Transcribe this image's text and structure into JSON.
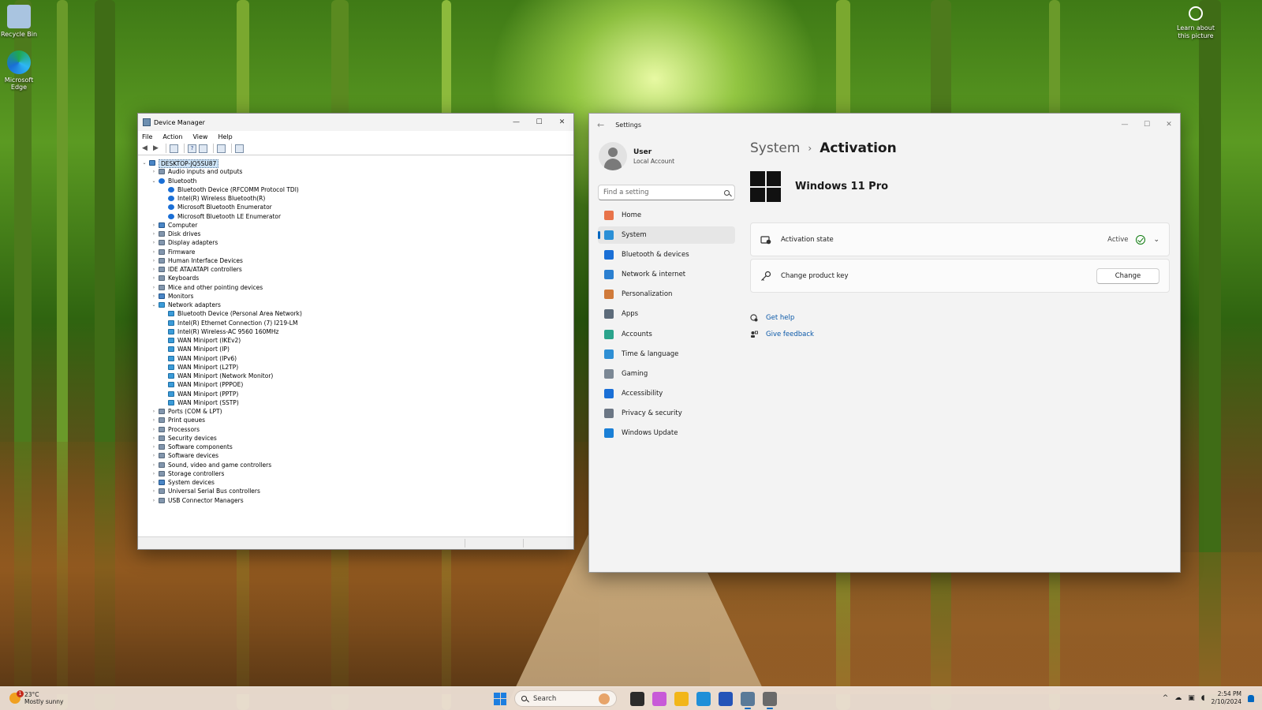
{
  "desktop": {
    "icons": [
      {
        "label": "Recycle Bin"
      },
      {
        "label": "Microsoft Edge"
      }
    ],
    "learn_picture": "Learn about this picture"
  },
  "device_manager": {
    "title": "Device Manager",
    "menu": [
      "File",
      "Action",
      "View",
      "Help"
    ],
    "toolbar_icons": [
      "back-arrow-icon",
      "forward-arrow-icon",
      "properties-icon",
      "help-icon",
      "view-icon",
      "scan-hardware-icon",
      "monitor-icon"
    ],
    "tree": [
      {
        "label": "DESKTOP-JQ5SU87",
        "level": 0,
        "expander": "expanded",
        "icon": "pc",
        "root": true
      },
      {
        "label": "Audio inputs and outputs",
        "level": 1,
        "expander": "collapsed",
        "icon": "cat"
      },
      {
        "label": "Bluetooth",
        "level": 1,
        "expander": "expanded",
        "icon": "bt"
      },
      {
        "label": "Bluetooth Device (RFCOMM Protocol TDI)",
        "level": 2,
        "expander": "none",
        "icon": "bt"
      },
      {
        "label": "Intel(R) Wireless Bluetooth(R)",
        "level": 2,
        "expander": "none",
        "icon": "bt"
      },
      {
        "label": "Microsoft Bluetooth Enumerator",
        "level": 2,
        "expander": "none",
        "icon": "bt"
      },
      {
        "label": "Microsoft Bluetooth LE Enumerator",
        "level": 2,
        "expander": "none",
        "icon": "bt"
      },
      {
        "label": "Computer",
        "level": 1,
        "expander": "collapsed",
        "icon": "pc"
      },
      {
        "label": "Disk drives",
        "level": 1,
        "expander": "collapsed",
        "icon": "cat"
      },
      {
        "label": "Display adapters",
        "level": 1,
        "expander": "collapsed",
        "icon": "cat"
      },
      {
        "label": "Firmware",
        "level": 1,
        "expander": "collapsed",
        "icon": "cat"
      },
      {
        "label": "Human Interface Devices",
        "level": 1,
        "expander": "collapsed",
        "icon": "cat"
      },
      {
        "label": "IDE ATA/ATAPI controllers",
        "level": 1,
        "expander": "collapsed",
        "icon": "cat"
      },
      {
        "label": "Keyboards",
        "level": 1,
        "expander": "collapsed",
        "icon": "cat"
      },
      {
        "label": "Mice and other pointing devices",
        "level": 1,
        "expander": "collapsed",
        "icon": "cat"
      },
      {
        "label": "Monitors",
        "level": 1,
        "expander": "collapsed",
        "icon": "pc"
      },
      {
        "label": "Network adapters",
        "level": 1,
        "expander": "expanded",
        "icon": "net"
      },
      {
        "label": "Bluetooth Device (Personal Area Network)",
        "level": 2,
        "expander": "none",
        "icon": "net"
      },
      {
        "label": "Intel(R) Ethernet Connection (7) I219-LM",
        "level": 2,
        "expander": "none",
        "icon": "net"
      },
      {
        "label": "Intel(R) Wireless-AC 9560 160MHz",
        "level": 2,
        "expander": "none",
        "icon": "net"
      },
      {
        "label": "WAN Miniport (IKEv2)",
        "level": 2,
        "expander": "none",
        "icon": "net"
      },
      {
        "label": "WAN Miniport (IP)",
        "level": 2,
        "expander": "none",
        "icon": "net"
      },
      {
        "label": "WAN Miniport (IPv6)",
        "level": 2,
        "expander": "none",
        "icon": "net"
      },
      {
        "label": "WAN Miniport (L2TP)",
        "level": 2,
        "expander": "none",
        "icon": "net"
      },
      {
        "label": "WAN Miniport (Network Monitor)",
        "level": 2,
        "expander": "none",
        "icon": "net"
      },
      {
        "label": "WAN Miniport (PPPOE)",
        "level": 2,
        "expander": "none",
        "icon": "net"
      },
      {
        "label": "WAN Miniport (PPTP)",
        "level": 2,
        "expander": "none",
        "icon": "net"
      },
      {
        "label": "WAN Miniport (SSTP)",
        "level": 2,
        "expander": "none",
        "icon": "net"
      },
      {
        "label": "Ports (COM & LPT)",
        "level": 1,
        "expander": "collapsed",
        "icon": "cat"
      },
      {
        "label": "Print queues",
        "level": 1,
        "expander": "collapsed",
        "icon": "cat"
      },
      {
        "label": "Processors",
        "level": 1,
        "expander": "collapsed",
        "icon": "cat"
      },
      {
        "label": "Security devices",
        "level": 1,
        "expander": "collapsed",
        "icon": "cat"
      },
      {
        "label": "Software components",
        "level": 1,
        "expander": "collapsed",
        "icon": "cat"
      },
      {
        "label": "Software devices",
        "level": 1,
        "expander": "collapsed",
        "icon": "cat"
      },
      {
        "label": "Sound, video and game controllers",
        "level": 1,
        "expander": "collapsed",
        "icon": "cat"
      },
      {
        "label": "Storage controllers",
        "level": 1,
        "expander": "collapsed",
        "icon": "cat"
      },
      {
        "label": "System devices",
        "level": 1,
        "expander": "collapsed",
        "icon": "pc"
      },
      {
        "label": "Universal Serial Bus controllers",
        "level": 1,
        "expander": "collapsed",
        "icon": "cat"
      },
      {
        "label": "USB Connector Managers",
        "level": 1,
        "expander": "collapsed",
        "icon": "cat"
      }
    ]
  },
  "settings": {
    "title": "Settings",
    "user": {
      "name": "User",
      "account": "Local Account"
    },
    "search_placeholder": "Find a setting",
    "nav": [
      {
        "label": "Home",
        "icon": "home-icon",
        "color": "#e8734a",
        "active": false
      },
      {
        "label": "System",
        "icon": "system-icon",
        "color": "#2a8fd6",
        "active": true
      },
      {
        "label": "Bluetooth & devices",
        "icon": "bluetooth-icon",
        "color": "#1a6fd6",
        "active": false
      },
      {
        "label": "Network & internet",
        "icon": "wifi-icon",
        "color": "#2b7fd0",
        "active": false
      },
      {
        "label": "Personalization",
        "icon": "brush-icon",
        "color": "#d07a3a",
        "active": false
      },
      {
        "label": "Apps",
        "icon": "apps-icon",
        "color": "#5d6b7a",
        "active": false
      },
      {
        "label": "Accounts",
        "icon": "accounts-icon",
        "color": "#2aa38b",
        "active": false
      },
      {
        "label": "Time & language",
        "icon": "globe-icon",
        "color": "#2f8fd4",
        "active": false
      },
      {
        "label": "Gaming",
        "icon": "gamepad-icon",
        "color": "#7b8794",
        "active": false
      },
      {
        "label": "Accessibility",
        "icon": "accessibility-icon",
        "color": "#1a6fd6",
        "active": false
      },
      {
        "label": "Privacy & security",
        "icon": "shield-icon",
        "color": "#6b7684",
        "active": false
      },
      {
        "label": "Windows Update",
        "icon": "update-icon",
        "color": "#1a7fd6",
        "active": false
      }
    ],
    "breadcrumb": {
      "parent": "System",
      "current": "Activation"
    },
    "edition": "Windows 11 Pro",
    "activation_state": {
      "label": "Activation state",
      "status": "Active"
    },
    "product_key": {
      "label": "Change product key",
      "button": "Change"
    },
    "links": {
      "help": "Get help",
      "feedback": "Give feedback"
    }
  },
  "taskbar": {
    "weather": {
      "temp": "23°C",
      "condition": "Mostly sunny",
      "badge": "1"
    },
    "search_label": "Search",
    "apps": [
      {
        "name": "task-view-icon",
        "color": "#2b2b2b",
        "running": false
      },
      {
        "name": "copilot-icon",
        "color": "#c85ad8",
        "running": false
      },
      {
        "name": "file-explorer-icon",
        "color": "#f2b619",
        "running": false
      },
      {
        "name": "edge-icon",
        "color": "#1f8fd8",
        "running": false
      },
      {
        "name": "store-icon",
        "color": "#2454b8",
        "running": false
      },
      {
        "name": "device-manager-icon",
        "color": "#5a7a98",
        "running": true
      },
      {
        "name": "settings-icon",
        "color": "#6a6a6a",
        "running": true
      }
    ],
    "clock": {
      "time": "2:54 PM",
      "date": "2/10/2024"
    }
  }
}
